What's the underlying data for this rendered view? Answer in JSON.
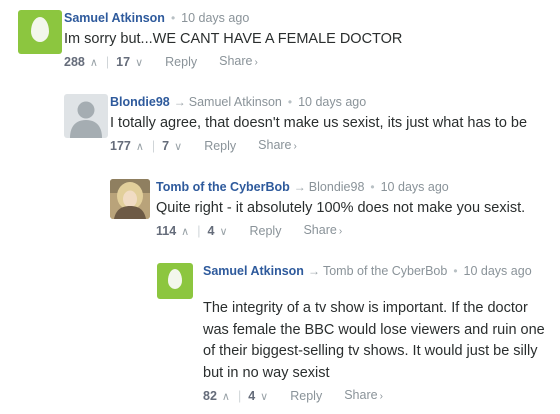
{
  "comments": [
    {
      "author": "Samuel Atkinson",
      "parent": "",
      "time": "10 days ago",
      "text": "Im sorry but...WE CANT HAVE A FEMALE DOCTOR",
      "upvotes": "288",
      "downvotes": "17",
      "reply_label": "Reply",
      "share_label": "Share",
      "avatar": "egg-avatar"
    },
    {
      "author": "Blondie98",
      "parent": "Samuel Atkinson",
      "time": "10 days ago",
      "text": "I totally agree, that doesn't make us sexist, its just what has to be",
      "upvotes": "177",
      "downvotes": "7",
      "reply_label": "Reply",
      "share_label": "Share",
      "avatar": "default-user-avatar"
    },
    {
      "author": "Tomb of the CyberBob",
      "parent": "Blondie98",
      "time": "10 days ago",
      "text": "Quite right - it absolutely 100% does not make you sexist.",
      "upvotes": "114",
      "downvotes": "4",
      "reply_label": "Reply",
      "share_label": "Share",
      "avatar": "photo-avatar"
    },
    {
      "author": "Samuel Atkinson",
      "parent": "Tomb of the CyberBob",
      "time": "10 days ago",
      "text": "The integrity of a tv show is important. If the doctor was female the BBC would lose viewers and ruin one of their biggest-selling tv shows. It would just be silly but in no way sexist",
      "upvotes": "82",
      "downvotes": "4",
      "reply_label": "Reply",
      "share_label": "Share",
      "avatar": "egg-avatar"
    }
  ],
  "icons": {
    "reply_arrow": "→",
    "dot": "•",
    "upvote": "∧",
    "downvote": "∨",
    "share_caret": "›"
  },
  "colors": {
    "author": "#2e5a9c",
    "egg_avatar": "#8cc63f",
    "muted": "#8a9399"
  }
}
